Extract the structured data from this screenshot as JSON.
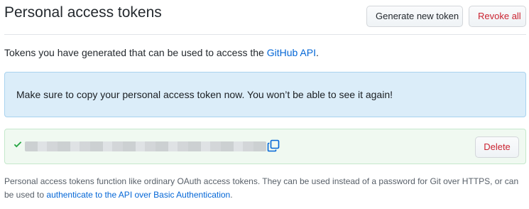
{
  "header": {
    "title": "Personal access tokens",
    "generate_label": "Generate new token",
    "revoke_label": "Revoke all"
  },
  "intro": {
    "text": "Tokens you have generated that can be used to access the ",
    "link": "GitHub API",
    "suffix": "."
  },
  "flash": {
    "text": "Make sure to copy your personal access token now. You won’t be able to see it again!"
  },
  "token": {
    "check_icon": "check-icon",
    "copy_icon": "clipboard-copy-icon",
    "delete_label": "Delete"
  },
  "footer": {
    "text": "Personal access tokens function like ordinary OAuth access tokens. They can be used instead of a password for Git over HTTPS, or can be used to ",
    "link": "authenticate to the API over Basic Authentication",
    "suffix": "."
  },
  "colors": {
    "link": "#0366d6",
    "danger": "#cb2431",
    "success": "#28a745",
    "flash_bg": "#dbedf9",
    "token_bg": "#f0f9f1"
  }
}
